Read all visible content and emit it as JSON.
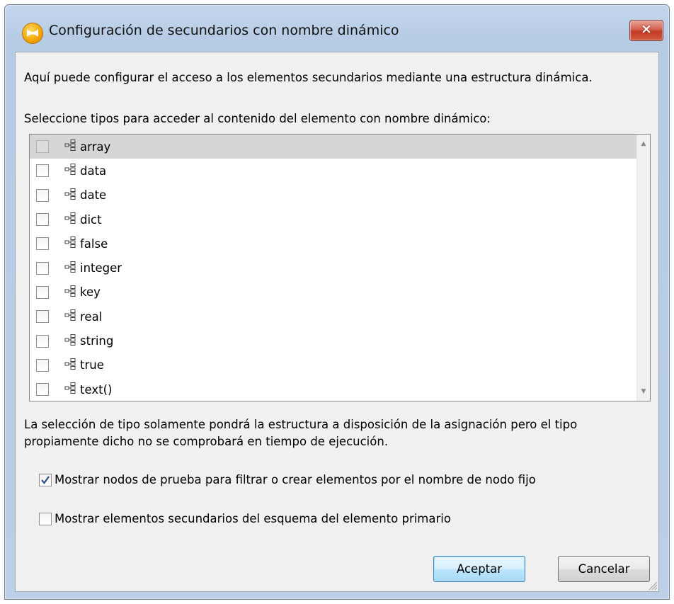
{
  "window": {
    "title": "Configuración de secundarios con nombre dinámico",
    "close_label": "×"
  },
  "intro_text": "Aquí puede configurar el acceso a los elementos secundarios mediante una estructura dinámica.",
  "select_label": "Seleccione tipos para acceder al contenido del elemento con nombre dinámico:",
  "types": [
    {
      "label": "array",
      "checked": false,
      "selected": true
    },
    {
      "label": "data",
      "checked": false,
      "selected": false
    },
    {
      "label": "date",
      "checked": false,
      "selected": false
    },
    {
      "label": "dict",
      "checked": false,
      "selected": false
    },
    {
      "label": "false",
      "checked": false,
      "selected": false
    },
    {
      "label": "integer",
      "checked": false,
      "selected": false
    },
    {
      "label": "key",
      "checked": false,
      "selected": false
    },
    {
      "label": "real",
      "checked": false,
      "selected": false
    },
    {
      "label": "string",
      "checked": false,
      "selected": false
    },
    {
      "label": "true",
      "checked": false,
      "selected": false
    },
    {
      "label": "text()",
      "checked": false,
      "selected": false
    }
  ],
  "note_text": "La selección de tipo solamente pondrá la estructura a disposición de la asignación pero el tipo propiamente dicho no se comprobará en tiempo de ejecución.",
  "options": {
    "show_test_nodes": {
      "label": "Mostrar nodos de prueba para filtrar o crear elementos por el nombre de nodo fijo",
      "checked": true
    },
    "show_schema_children": {
      "label": "Mostrar elementos secundarios del esquema del elemento primario",
      "checked": false
    }
  },
  "buttons": {
    "ok": "Aceptar",
    "cancel": "Cancelar"
  },
  "icons": {
    "app": "mapforce-logo-icon",
    "node": "tree-node-icon"
  }
}
